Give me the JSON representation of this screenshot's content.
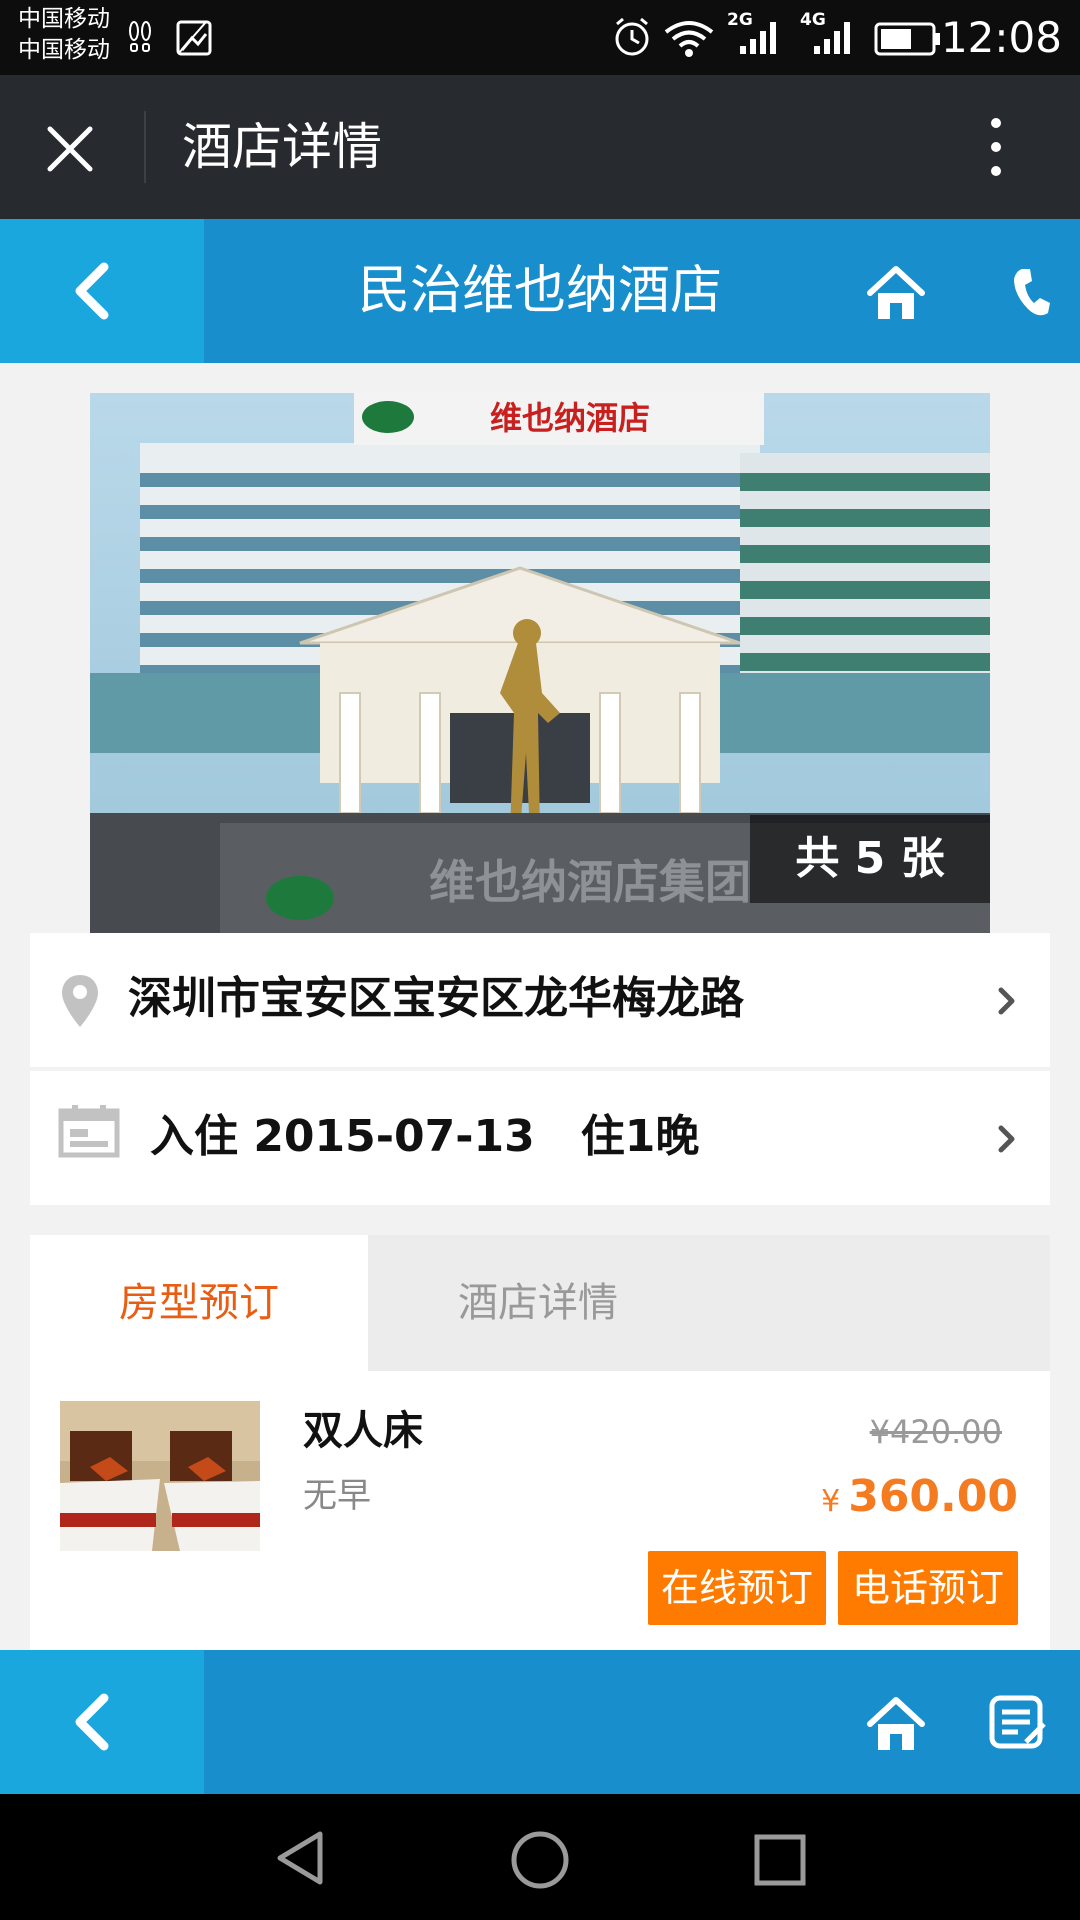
{
  "status_bar": {
    "carrier_1": "中国移动",
    "carrier_2": "中国移动",
    "net_2g": "2G",
    "net_4g": "4G",
    "time": "12:08"
  },
  "wechat_bar": {
    "title": "酒店详情",
    "icons": [
      "close-icon",
      "more-icon"
    ]
  },
  "header": {
    "title": "民治维也纳酒店",
    "icons": [
      "back-icon",
      "home-icon",
      "phone-icon"
    ],
    "color": "#188fcc",
    "back_bg": "#1aa7de"
  },
  "gallery": {
    "count_label": "共 5 张",
    "sign_text": "维也纳酒店",
    "wall_text": "维也纳酒店集团"
  },
  "address_row": {
    "icon": "location-pin-icon",
    "text": "深圳市宝安区宝安区龙华梅龙路"
  },
  "checkin_row": {
    "icon": "calendar-icon",
    "text": "入住 2015-07-13   住1晚"
  },
  "tabs": [
    {
      "label": "房型预订",
      "active": true
    },
    {
      "label": "酒店详情",
      "active": false
    }
  ],
  "rooms": [
    {
      "name": "双人床",
      "breakfast": "无早",
      "original_price": "¥420.00",
      "currency": "¥",
      "price": "360.00",
      "book_online": "在线预订",
      "book_phone": "电话预订"
    }
  ],
  "bottom_bar": {
    "icons": [
      "back-icon",
      "home-icon",
      "notes-icon"
    ]
  },
  "colors": {
    "accent_orange": "#ff7b00",
    "price_orange": "#f57b20",
    "tab_active": "#e95d12"
  }
}
